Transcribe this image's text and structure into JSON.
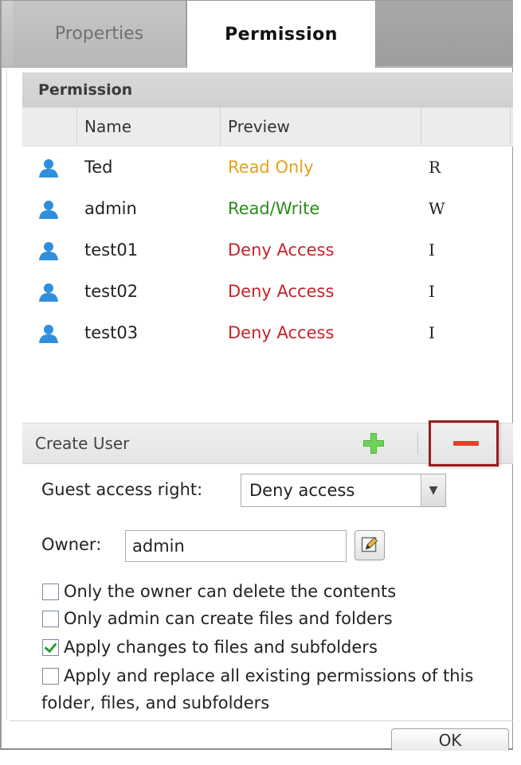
{
  "tabs": [
    {
      "label": "Properties",
      "active": false
    },
    {
      "label": "Permission",
      "active": true
    }
  ],
  "section_title": "Permission",
  "table": {
    "columns": [
      "Name",
      "Preview"
    ],
    "rows": [
      {
        "name": "Ted",
        "preview": "Read Only",
        "code": "R",
        "preview_color": "#e3a21a"
      },
      {
        "name": "admin",
        "preview": "Read/Write",
        "code": "W",
        "preview_color": "#2d8a1e"
      },
      {
        "name": "test01",
        "preview": "Deny Access",
        "code": "I",
        "preview_color": "#c4242a"
      },
      {
        "name": "test02",
        "preview": "Deny Access",
        "code": "I",
        "preview_color": "#c4242a"
      },
      {
        "name": "test03",
        "preview": "Deny Access",
        "code": "I",
        "preview_color": "#c4242a"
      }
    ]
  },
  "toolbar": {
    "label": "Create User",
    "add_icon": "plus-icon",
    "remove_icon": "minus-icon",
    "highlight_color": "#9b1c20"
  },
  "guest_access": {
    "label": "Guest access right:",
    "value": "Deny access"
  },
  "owner": {
    "label": "Owner:",
    "value": "admin",
    "edit_icon": "pencil-edit-icon"
  },
  "options": [
    {
      "label": "Only the owner can delete the contents",
      "checked": false
    },
    {
      "label": "Only admin can create files and folders",
      "checked": false
    },
    {
      "label": "Apply changes to files and subfolders",
      "checked": true
    },
    {
      "label": "Apply and replace all existing permissions of this",
      "label_cont": "folder, files, and subfolders",
      "checked": false
    }
  ],
  "ok_label": "OK"
}
